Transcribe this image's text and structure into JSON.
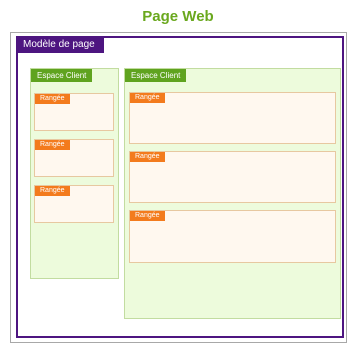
{
  "page": {
    "title": "Page Web"
  },
  "template": {
    "label": "Modèle de page"
  },
  "spaces": [
    {
      "label": "Espace Client",
      "rows": [
        "Rangée",
        "Rangée",
        "Rangée"
      ]
    },
    {
      "label": "Espace Client",
      "rows": [
        "Rangée",
        "Rangée",
        "Rangée"
      ]
    }
  ],
  "colors": {
    "title": "#6aa81e",
    "template": "#4d1580",
    "space_tag": "#5fa31f",
    "space_fill": "#edfbdc",
    "row_tag": "#f37b1d",
    "row_fill": "#fff8ef"
  }
}
